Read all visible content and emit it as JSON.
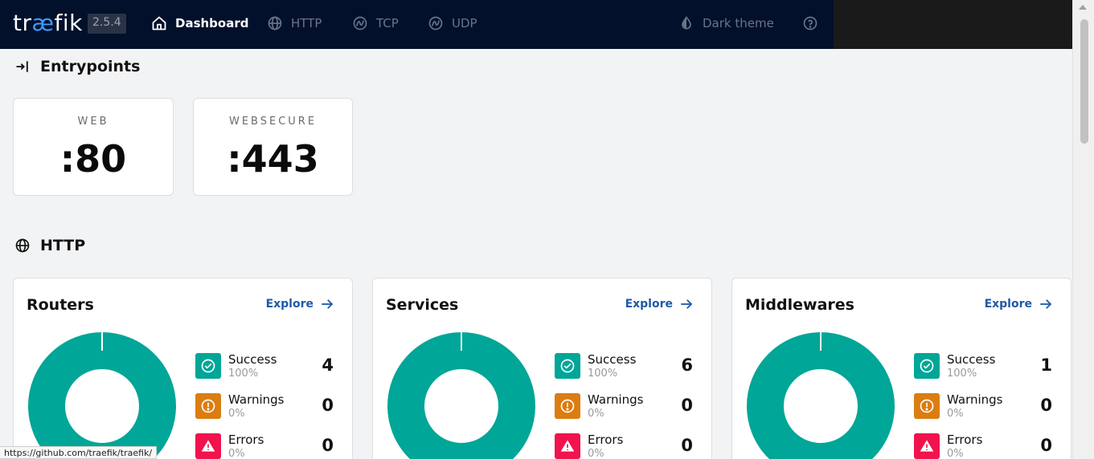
{
  "nav": {
    "logo_prefix": "tr",
    "logo_ae": "æ",
    "logo_suffix": "fik",
    "version": "2.5.4",
    "items": [
      {
        "label": "Dashboard",
        "icon": "home-icon"
      },
      {
        "label": "HTTP",
        "icon": "globe-icon"
      },
      {
        "label": "TCP",
        "icon": "tcp-icon"
      },
      {
        "label": "UDP",
        "icon": "udp-icon"
      }
    ],
    "theme_label": "Dark theme",
    "help_icon": "help-icon"
  },
  "entrypoints": {
    "title": "Entrypoints",
    "items": [
      {
        "name": "WEB",
        "port": ":80"
      },
      {
        "name": "WEBSECURE",
        "port": ":443"
      }
    ]
  },
  "http": {
    "title": "HTTP",
    "explore_label": "Explore",
    "panels": [
      {
        "title": "Routers",
        "success": {
          "label": "Success",
          "pct": "100%",
          "count": "4"
        },
        "warnings": {
          "label": "Warnings",
          "pct": "0%",
          "count": "0"
        },
        "errors": {
          "label": "Errors",
          "pct": "0%",
          "count": "0"
        }
      },
      {
        "title": "Services",
        "success": {
          "label": "Success",
          "pct": "100%",
          "count": "6"
        },
        "warnings": {
          "label": "Warnings",
          "pct": "0%",
          "count": "0"
        },
        "errors": {
          "label": "Errors",
          "pct": "0%",
          "count": "0"
        }
      },
      {
        "title": "Middlewares",
        "success": {
          "label": "Success",
          "pct": "100%",
          "count": "1"
        },
        "warnings": {
          "label": "Warnings",
          "pct": "0%",
          "count": "0"
        },
        "errors": {
          "label": "Errors",
          "pct": "0%",
          "count": "0"
        }
      }
    ]
  },
  "colors": {
    "success": "#00a697",
    "warning": "#db7d11",
    "error": "#f0134d",
    "nav_bg": "#03102b"
  },
  "status_bar_url": "https://github.com/traefik/traefik/"
}
